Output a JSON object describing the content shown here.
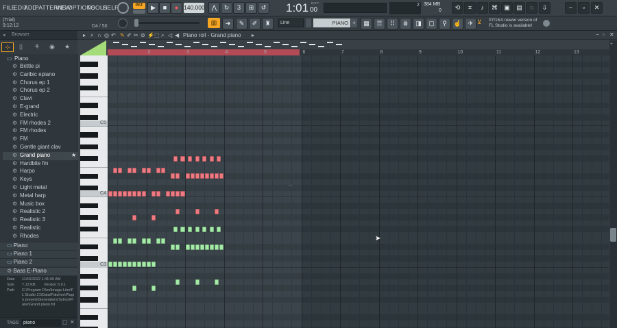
{
  "menu": [
    "FILE",
    "EDIT",
    "ADD",
    "PATTERNS",
    "VIEW",
    "OPTIONS",
    "TOOLS",
    "HELP"
  ],
  "transport": {
    "pattern_badge": "PAT",
    "tempo": "140.000",
    "time": "1:01",
    "time_sub": "00",
    "time_unit": "B:S:T"
  },
  "memory": {
    "cpu_value": "2",
    "mem": "384 MB",
    "voices": "0"
  },
  "trial": {
    "label": "(Trial)",
    "time": "9:12:12",
    "position": "D4 / 50"
  },
  "toolbar2": {
    "snap": "Line",
    "instrument": "PIANO"
  },
  "news": {
    "date": "07/16",
    "line1": "A newer version of",
    "line2": "FL Studio is available!"
  },
  "browser": {
    "title": "Browser",
    "folder": "Piano",
    "items": [
      "Brittle pi",
      "Caribic epiano",
      "Chorus ep 1",
      "Chorus ep 2",
      "Clavi",
      "E-grand",
      "Electric",
      "FM rhodes 2",
      "FM rhodes",
      "FM",
      "Gentle giant clav",
      "Grand piano",
      "Hardbite fm",
      "Harpo",
      "Keys",
      "Light metal",
      "Metal harp",
      "Music box",
      "Realistic 2",
      "Realistic 3",
      "Realistic",
      "Rhodes"
    ],
    "selected_index": 11,
    "folders_below": [
      "Piano",
      "Piano 1",
      "Piano 2"
    ],
    "bass_item": "Bass E-Piano"
  },
  "info": {
    "date_label": "Date",
    "date": "11/16/2022 1:41:00 AM",
    "size_label": "Size",
    "size": "7.13 KB",
    "version": "Version 5.9.1",
    "path_label": "Path",
    "path": "C:\\Program Files\\Image-Line\\FL Studio 21\\Data\\Patches\\Plugin presets\\Generators\\Sytrus\\Piano\\Grand piano.fst"
  },
  "tags": {
    "label": "TAGS",
    "value": "piano"
  },
  "pianoroll": {
    "title": "Piano roll - Grand piano",
    "bars": [
      "2",
      "3",
      "4",
      "5",
      "6",
      "7",
      "8",
      "9",
      "10",
      "11",
      "12",
      "13"
    ],
    "key_labels": [
      "C5",
      "C4",
      "C3"
    ]
  },
  "colors": {
    "red_note": "#f07a82",
    "green_note": "#a4eba8",
    "accent": "#f5a623"
  }
}
